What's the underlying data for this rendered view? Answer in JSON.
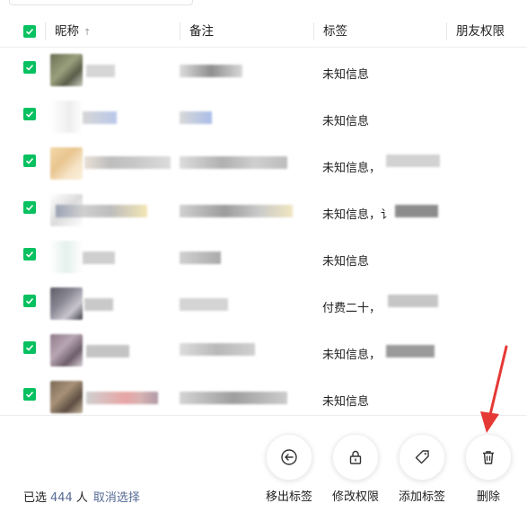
{
  "header": {
    "nickname": "昵称",
    "sort_icon": "↑",
    "remark": "备注",
    "tags": "标签",
    "permission": "朋友权限"
  },
  "rows": [
    {
      "tag": "未知信息"
    },
    {
      "tag": "未知信息"
    },
    {
      "tag": "未知信息，"
    },
    {
      "tag": "未知信息，讠"
    },
    {
      "tag": "未知信息"
    },
    {
      "tag": "付费二十，"
    },
    {
      "tag": "未知信息，"
    },
    {
      "tag": "未知信息"
    }
  ],
  "footer": {
    "selected_prefix": "已选",
    "selected_count": "444",
    "selected_suffix": "人",
    "cancel_selection": "取消选择",
    "actions": [
      {
        "label": "移出标签",
        "icon": "remove-from-tag-icon"
      },
      {
        "label": "修改权限",
        "icon": "lock-icon"
      },
      {
        "label": "添加标签",
        "icon": "tag-icon"
      },
      {
        "label": "删除",
        "icon": "trash-icon"
      }
    ]
  },
  "colors": {
    "accent": "#07c160",
    "link": "#576b95",
    "arrow": "#e53935"
  }
}
